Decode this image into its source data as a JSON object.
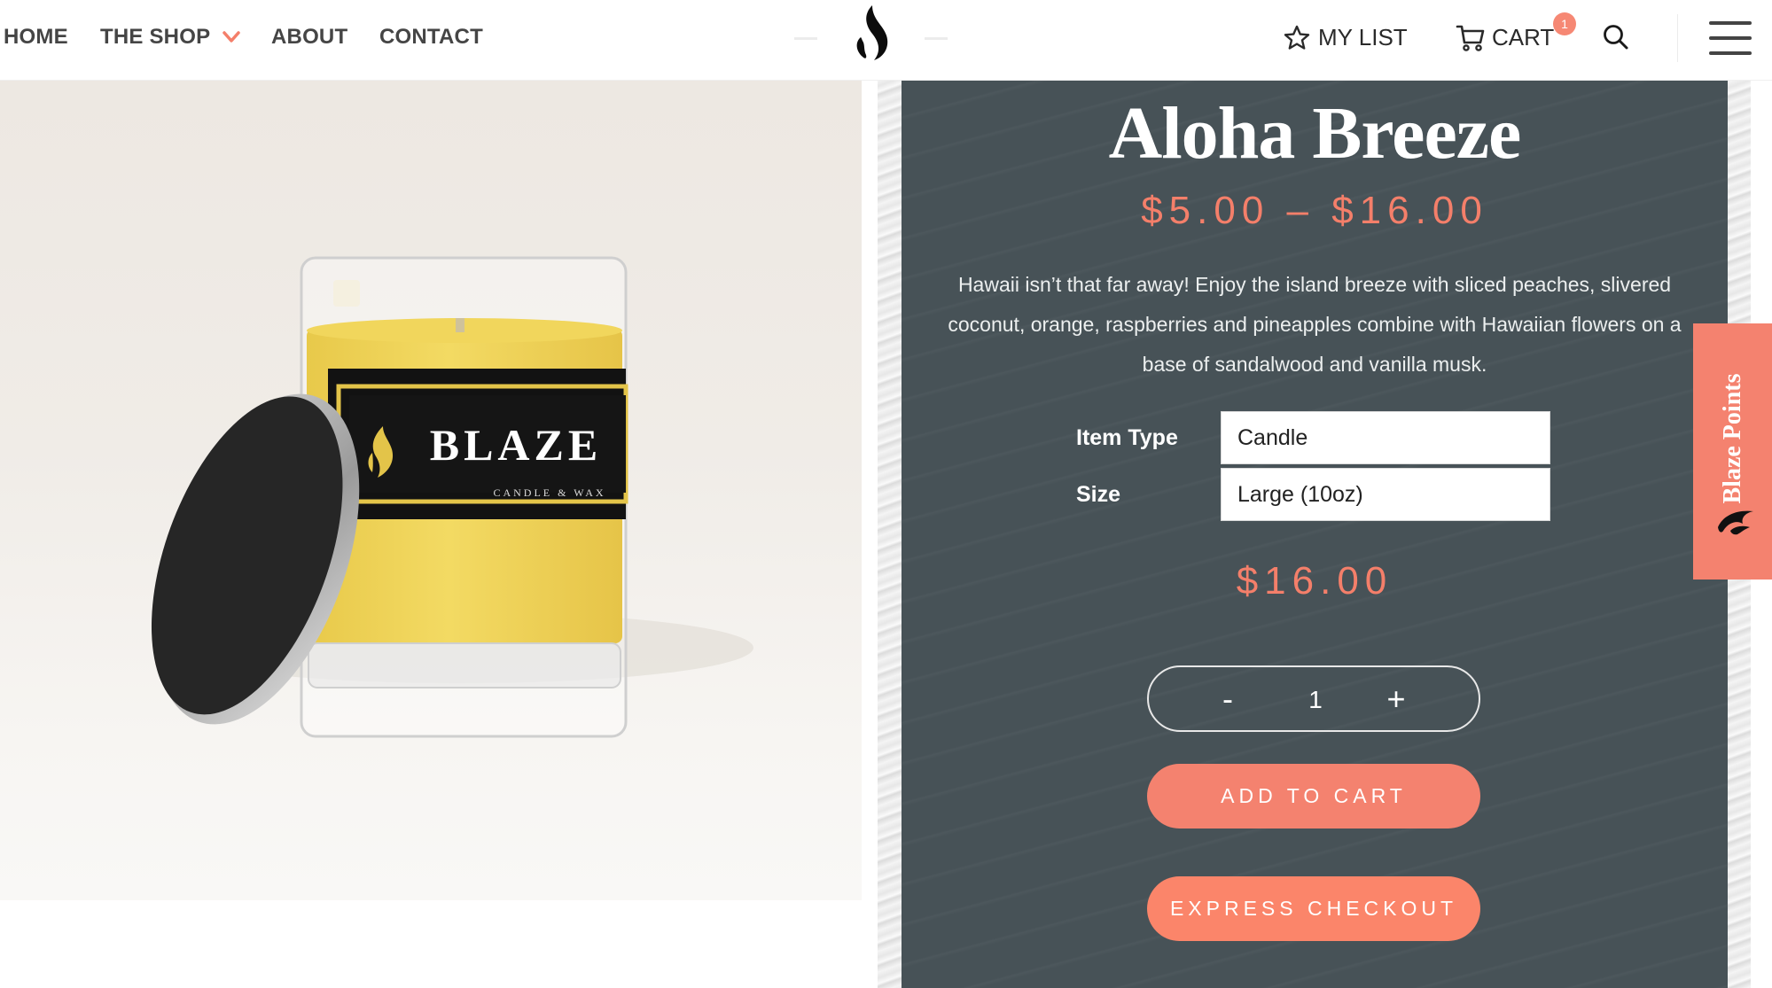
{
  "header": {
    "nav": [
      {
        "label": "HOME"
      },
      {
        "label": "THE SHOP",
        "has_dropdown": true
      },
      {
        "label": "ABOUT"
      },
      {
        "label": "CONTACT"
      }
    ],
    "logo_icon": "flame-icon",
    "my_list_label": "MY LIST",
    "cart_label": "CART",
    "cart_count": "1",
    "search_icon": "search-icon",
    "menu_icon": "hamburger-icon"
  },
  "product": {
    "image_alt": "Blaze candle jar with lid",
    "jar_brand": "BLAZE",
    "jar_subtitle": "CANDLE & WAX",
    "title": "Aloha Breeze",
    "price_range": "$5.00 – $16.00",
    "description": "Hawaii isn’t that far away! Enjoy the island breeze with sliced peaches, slivered coconut, orange, raspberries and pineapples combine with Hawaiian flowers on a base of sandalwood and vanilla musk.",
    "options": [
      {
        "label": "Item Type",
        "value": "Candle"
      },
      {
        "label": "Size",
        "value": "Large (10oz)"
      }
    ],
    "selected_price": "$16.00",
    "quantity": "1",
    "decrement_label": "-",
    "increment_label": "+",
    "add_to_cart_label": "ADD TO CART",
    "express_checkout_label": "EXPRESS CHECKOUT"
  },
  "rewards_tab": {
    "label": "Blaze Points"
  },
  "colors": {
    "accent": "#f4826f",
    "panel": "#475257",
    "nav_text": "#454545"
  }
}
